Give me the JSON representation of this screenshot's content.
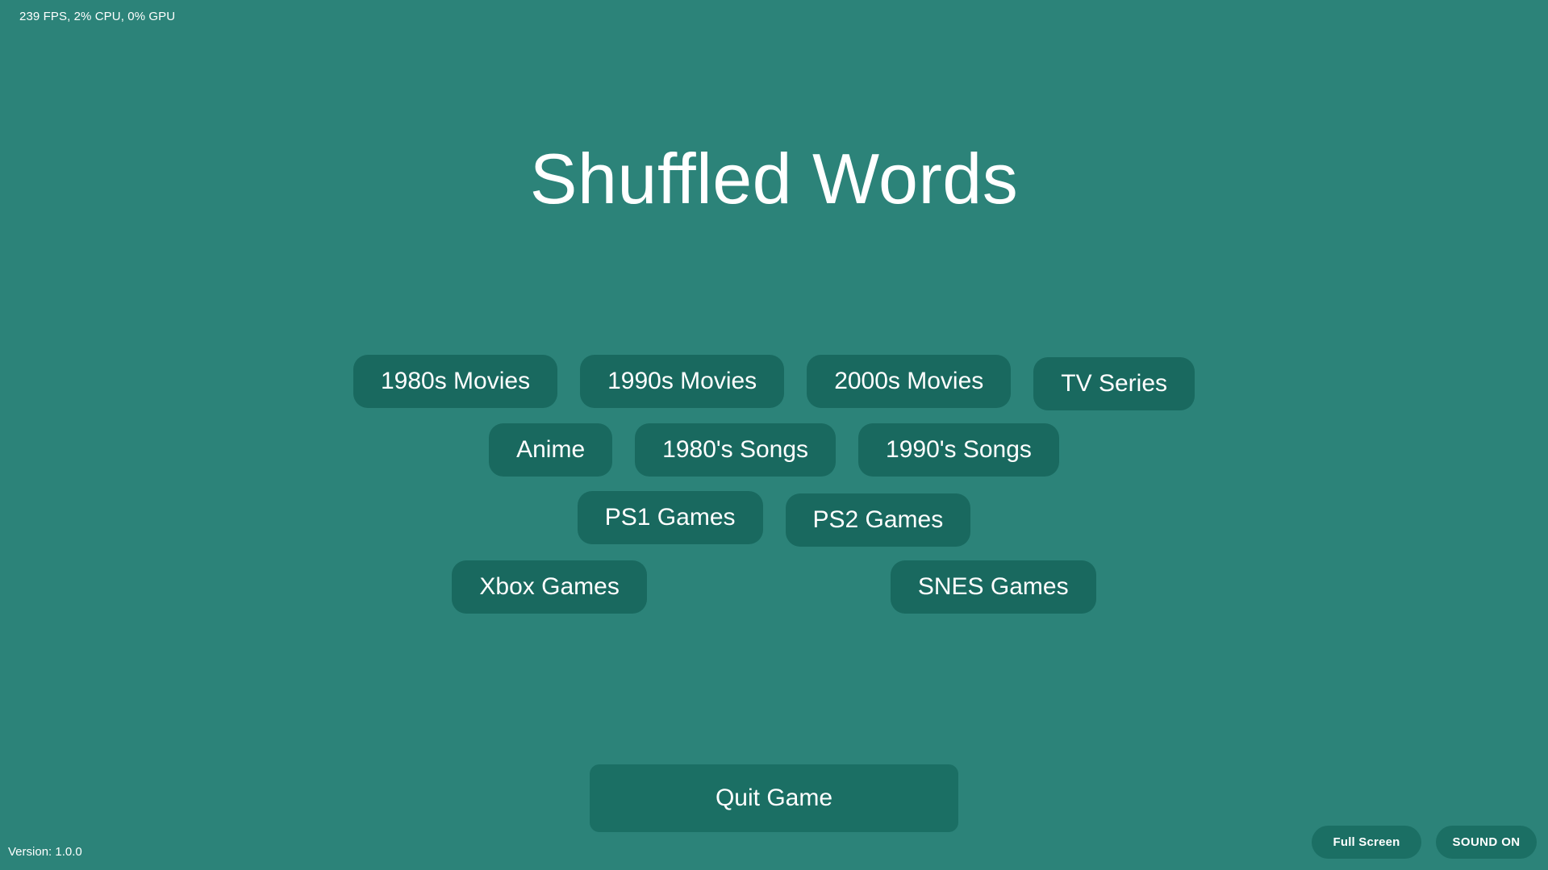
{
  "app": {
    "title": "Shuffled Words",
    "background_color": "#2c8379",
    "button_color": "#19695f",
    "text_color": "#ffffff"
  },
  "overlay": {
    "perf_stats": "239 FPS, 2% CPU, 0% GPU",
    "version": "Version: 1.0.0"
  },
  "categories": {
    "rows": [
      [
        {
          "label": "1980s Movies"
        },
        {
          "label": "1990s Movies"
        },
        {
          "label": "2000s Movies"
        },
        {
          "label": "TV Series"
        }
      ],
      [
        {
          "label": "Anime"
        },
        {
          "label": "1980's Songs"
        },
        {
          "label": "1990's Songs"
        }
      ],
      [
        {
          "label": "PS1 Games"
        },
        {
          "label": "PS2 Games"
        }
      ],
      [
        {
          "label": "Xbox Games"
        },
        {
          "label": "SNES Games"
        }
      ]
    ]
  },
  "actions": {
    "quit_label": "Quit Game",
    "fullscreen_label": "Full Screen",
    "sound_label": "SOUND ON"
  }
}
